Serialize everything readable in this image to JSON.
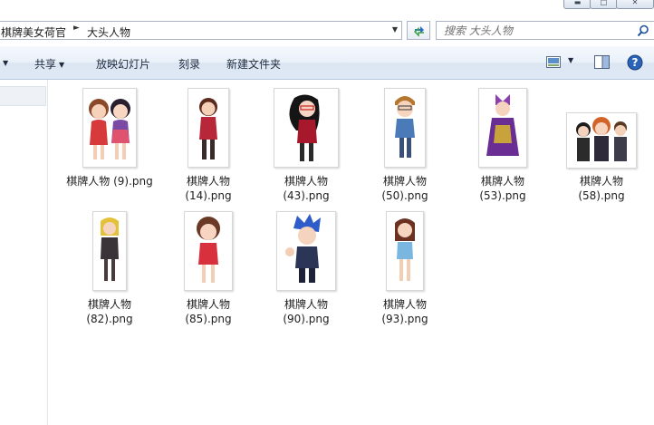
{
  "address": {
    "crumbs": [
      "棋牌美女荷官",
      "大头人物"
    ],
    "separator_icon": "triangle-right-icon",
    "dropdown_icon": "triangle-down-icon",
    "refresh_icon": "refresh-arrows-icon"
  },
  "search": {
    "placeholder": "搜索 大头人物",
    "icon": "magnifier-icon"
  },
  "toolbar": {
    "share_label": "共享",
    "slideshow_label": "放映幻灯片",
    "burn_label": "刻录",
    "new_folder_label": "新建文件夹",
    "views_icon": "change-view-icon",
    "preview_pane_icon": "preview-pane-icon",
    "help_icon": "help-icon"
  },
  "files": [
    {
      "line1": "棋牌人物",
      "line2": "(9).png"
    },
    {
      "line1": "棋牌人物",
      "line2": "(14).png"
    },
    {
      "line1": "棋牌人物",
      "line2": "(43).png"
    },
    {
      "line1": "棋牌人物",
      "line2": "(50).png"
    },
    {
      "line1": "棋牌人物",
      "line2": "(53).png"
    },
    {
      "line1": "棋牌人物",
      "line2": "(58).png"
    },
    {
      "line1": "棋牌人物",
      "line2": "(82).png"
    },
    {
      "line1": "棋牌人物",
      "line2": "(85).png"
    },
    {
      "line1": "棋牌人物",
      "line2": "(90).png"
    },
    {
      "line1": "棋牌人物",
      "line2": "(93).png"
    }
  ],
  "colors": {
    "toolbar_bg": "#dfe9f5",
    "help_blue": "#2a63b8",
    "border": "#aab4c4"
  }
}
